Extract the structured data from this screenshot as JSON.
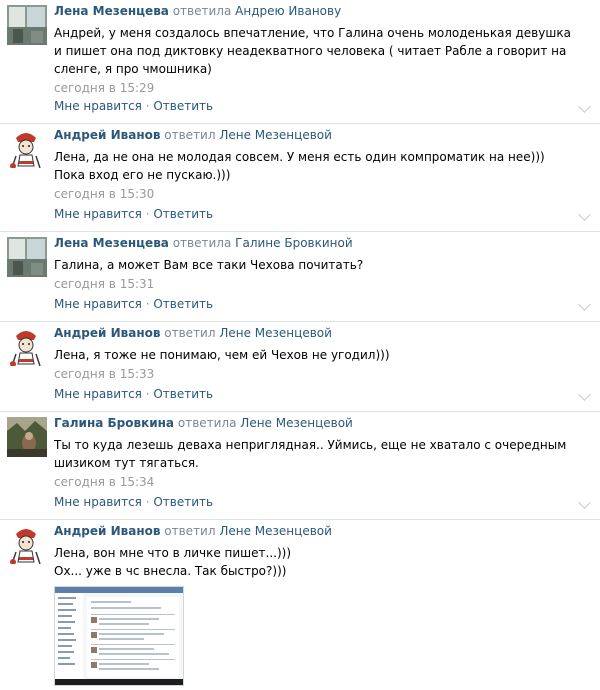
{
  "comments": [
    {
      "author": "Лена Мезенцева",
      "verb": "ответила",
      "target": "Андрею Иванову",
      "text": "Андрей, у меня создалось впечатление, что Галина очень молоденькая девушка и пишет она под диктовку неадекватного человека ( читает Рабле а говорит на сленге, я про чмошника)",
      "date": "сегодня в 15:29",
      "like": "Мне нравится",
      "sep": " · ",
      "reply": "Ответить",
      "avatar": "photo-window-avatar"
    },
    {
      "author": "Андрей Иванов",
      "verb": "ответил",
      "target": "Лене Мезенцевой",
      "text": "Лена, да не она не молодая совсем. У меня есть один компроматик на нее))) Пока вход его не пускаю.)))",
      "date": "сегодня в 15:30",
      "like": "Мне нравится",
      "sep": " · ",
      "reply": "Ответить",
      "avatar": "cartoon-avatar"
    },
    {
      "author": "Лена Мезенцева",
      "verb": "ответила",
      "target": "Галине Бровкиной",
      "text": "Галина, а может Вам все таки Чехова почитать?",
      "date": "сегодня в 15:31",
      "like": "Мне нравится",
      "sep": " · ",
      "reply": "Ответить",
      "avatar": "photo-window-avatar"
    },
    {
      "author": "Андрей Иванов",
      "verb": "ответил",
      "target": "Лене Мезенцевой",
      "text": "Лена, я тоже не понимаю, чем ей Чехов не угодил)))",
      "date": "сегодня в 15:33",
      "like": "Мне нравится",
      "sep": " · ",
      "reply": "Ответить",
      "avatar": "cartoon-avatar"
    },
    {
      "author": "Галина Бровкина",
      "verb": "ответила",
      "target": "Лене Мезенцевой",
      "text": "Ты то куда лезешь деваха непригляднaя.. Уймись, еще не хватало с очередным шизиком тут тягаться.",
      "date": "сегодня в 15:34",
      "like": "Мне нравится",
      "sep": " · ",
      "reply": "Ответить",
      "avatar": "photo-forest-avatar"
    },
    {
      "author": "Андрей Иванов",
      "verb": "ответил",
      "target": "Лене Мезенцевой",
      "text_line1": "Лена, вон мне что в личке пишет...)))",
      "text_line2": "Ох... уже в чс внесла. Так быстро?)))",
      "avatar": "cartoon-avatar",
      "attachment": "screenshot-thumbnail"
    }
  ]
}
